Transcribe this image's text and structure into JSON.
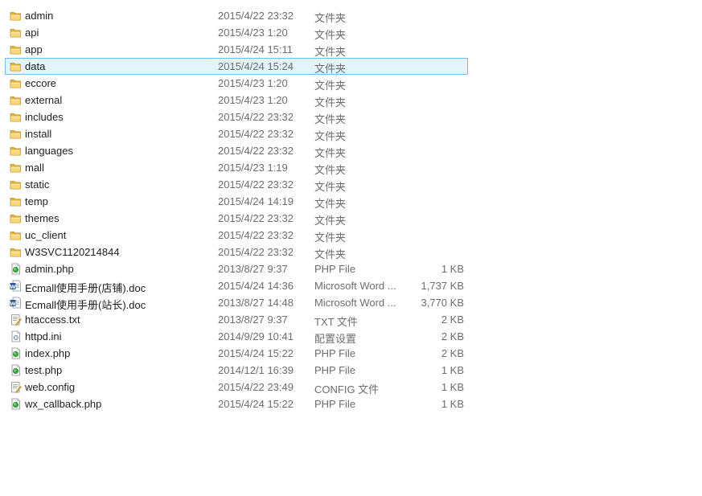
{
  "files": [
    {
      "name": "admin",
      "date": "2015/4/22 23:32",
      "type": "文件夹",
      "size": "",
      "icon": "folder-icon",
      "selected": false
    },
    {
      "name": "api",
      "date": "2015/4/23 1:20",
      "type": "文件夹",
      "size": "",
      "icon": "folder-icon",
      "selected": false
    },
    {
      "name": "app",
      "date": "2015/4/24 15:11",
      "type": "文件夹",
      "size": "",
      "icon": "folder-icon",
      "selected": false
    },
    {
      "name": "data",
      "date": "2015/4/24 15:24",
      "type": "文件夹",
      "size": "",
      "icon": "folder-icon",
      "selected": true
    },
    {
      "name": "eccore",
      "date": "2015/4/23 1:20",
      "type": "文件夹",
      "size": "",
      "icon": "folder-icon",
      "selected": false
    },
    {
      "name": "external",
      "date": "2015/4/23 1:20",
      "type": "文件夹",
      "size": "",
      "icon": "folder-icon",
      "selected": false
    },
    {
      "name": "includes",
      "date": "2015/4/22 23:32",
      "type": "文件夹",
      "size": "",
      "icon": "folder-icon",
      "selected": false
    },
    {
      "name": "install",
      "date": "2015/4/22 23:32",
      "type": "文件夹",
      "size": "",
      "icon": "folder-icon",
      "selected": false
    },
    {
      "name": "languages",
      "date": "2015/4/22 23:32",
      "type": "文件夹",
      "size": "",
      "icon": "folder-icon",
      "selected": false
    },
    {
      "name": "mall",
      "date": "2015/4/23 1:19",
      "type": "文件夹",
      "size": "",
      "icon": "folder-icon",
      "selected": false
    },
    {
      "name": "static",
      "date": "2015/4/22 23:32",
      "type": "文件夹",
      "size": "",
      "icon": "folder-icon",
      "selected": false
    },
    {
      "name": "temp",
      "date": "2015/4/24 14:19",
      "type": "文件夹",
      "size": "",
      "icon": "folder-icon",
      "selected": false
    },
    {
      "name": "themes",
      "date": "2015/4/22 23:32",
      "type": "文件夹",
      "size": "",
      "icon": "folder-icon",
      "selected": false
    },
    {
      "name": "uc_client",
      "date": "2015/4/22 23:32",
      "type": "文件夹",
      "size": "",
      "icon": "folder-icon",
      "selected": false
    },
    {
      "name": "W3SVC1120214844",
      "date": "2015/4/22 23:32",
      "type": "文件夹",
      "size": "",
      "icon": "folder-icon",
      "selected": false
    },
    {
      "name": "admin.php",
      "date": "2013/8/27 9:37",
      "type": "PHP File",
      "size": "1 KB",
      "icon": "php-file-icon",
      "selected": false
    },
    {
      "name": "Ecmall使用手册(店铺).doc",
      "date": "2015/4/24 14:36",
      "type": "Microsoft Word ...",
      "size": "1,737 KB",
      "icon": "word-doc-icon",
      "selected": false
    },
    {
      "name": "Ecmall使用手册(站长).doc",
      "date": "2013/8/27 14:48",
      "type": "Microsoft Word ...",
      "size": "3,770 KB",
      "icon": "word-doc-icon",
      "selected": false
    },
    {
      "name": "htaccess.txt",
      "date": "2013/8/27 9:37",
      "type": "TXT 文件",
      "size": "2 KB",
      "icon": "text-file-icon",
      "selected": false
    },
    {
      "name": "httpd.ini",
      "date": "2014/9/29 10:41",
      "type": "配置设置",
      "size": "2 KB",
      "icon": "ini-file-icon",
      "selected": false
    },
    {
      "name": "index.php",
      "date": "2015/4/24 15:22",
      "type": "PHP File",
      "size": "2 KB",
      "icon": "php-file-icon",
      "selected": false
    },
    {
      "name": "test.php",
      "date": "2014/12/1 16:39",
      "type": "PHP File",
      "size": "1 KB",
      "icon": "php-file-icon",
      "selected": false
    },
    {
      "name": "web.config",
      "date": "2015/4/22 23:49",
      "type": "CONFIG 文件",
      "size": "1 KB",
      "icon": "text-file-icon",
      "selected": false
    },
    {
      "name": "wx_callback.php",
      "date": "2015/4/24 15:22",
      "type": "PHP File",
      "size": "1 KB",
      "icon": "php-file-icon",
      "selected": false
    }
  ]
}
